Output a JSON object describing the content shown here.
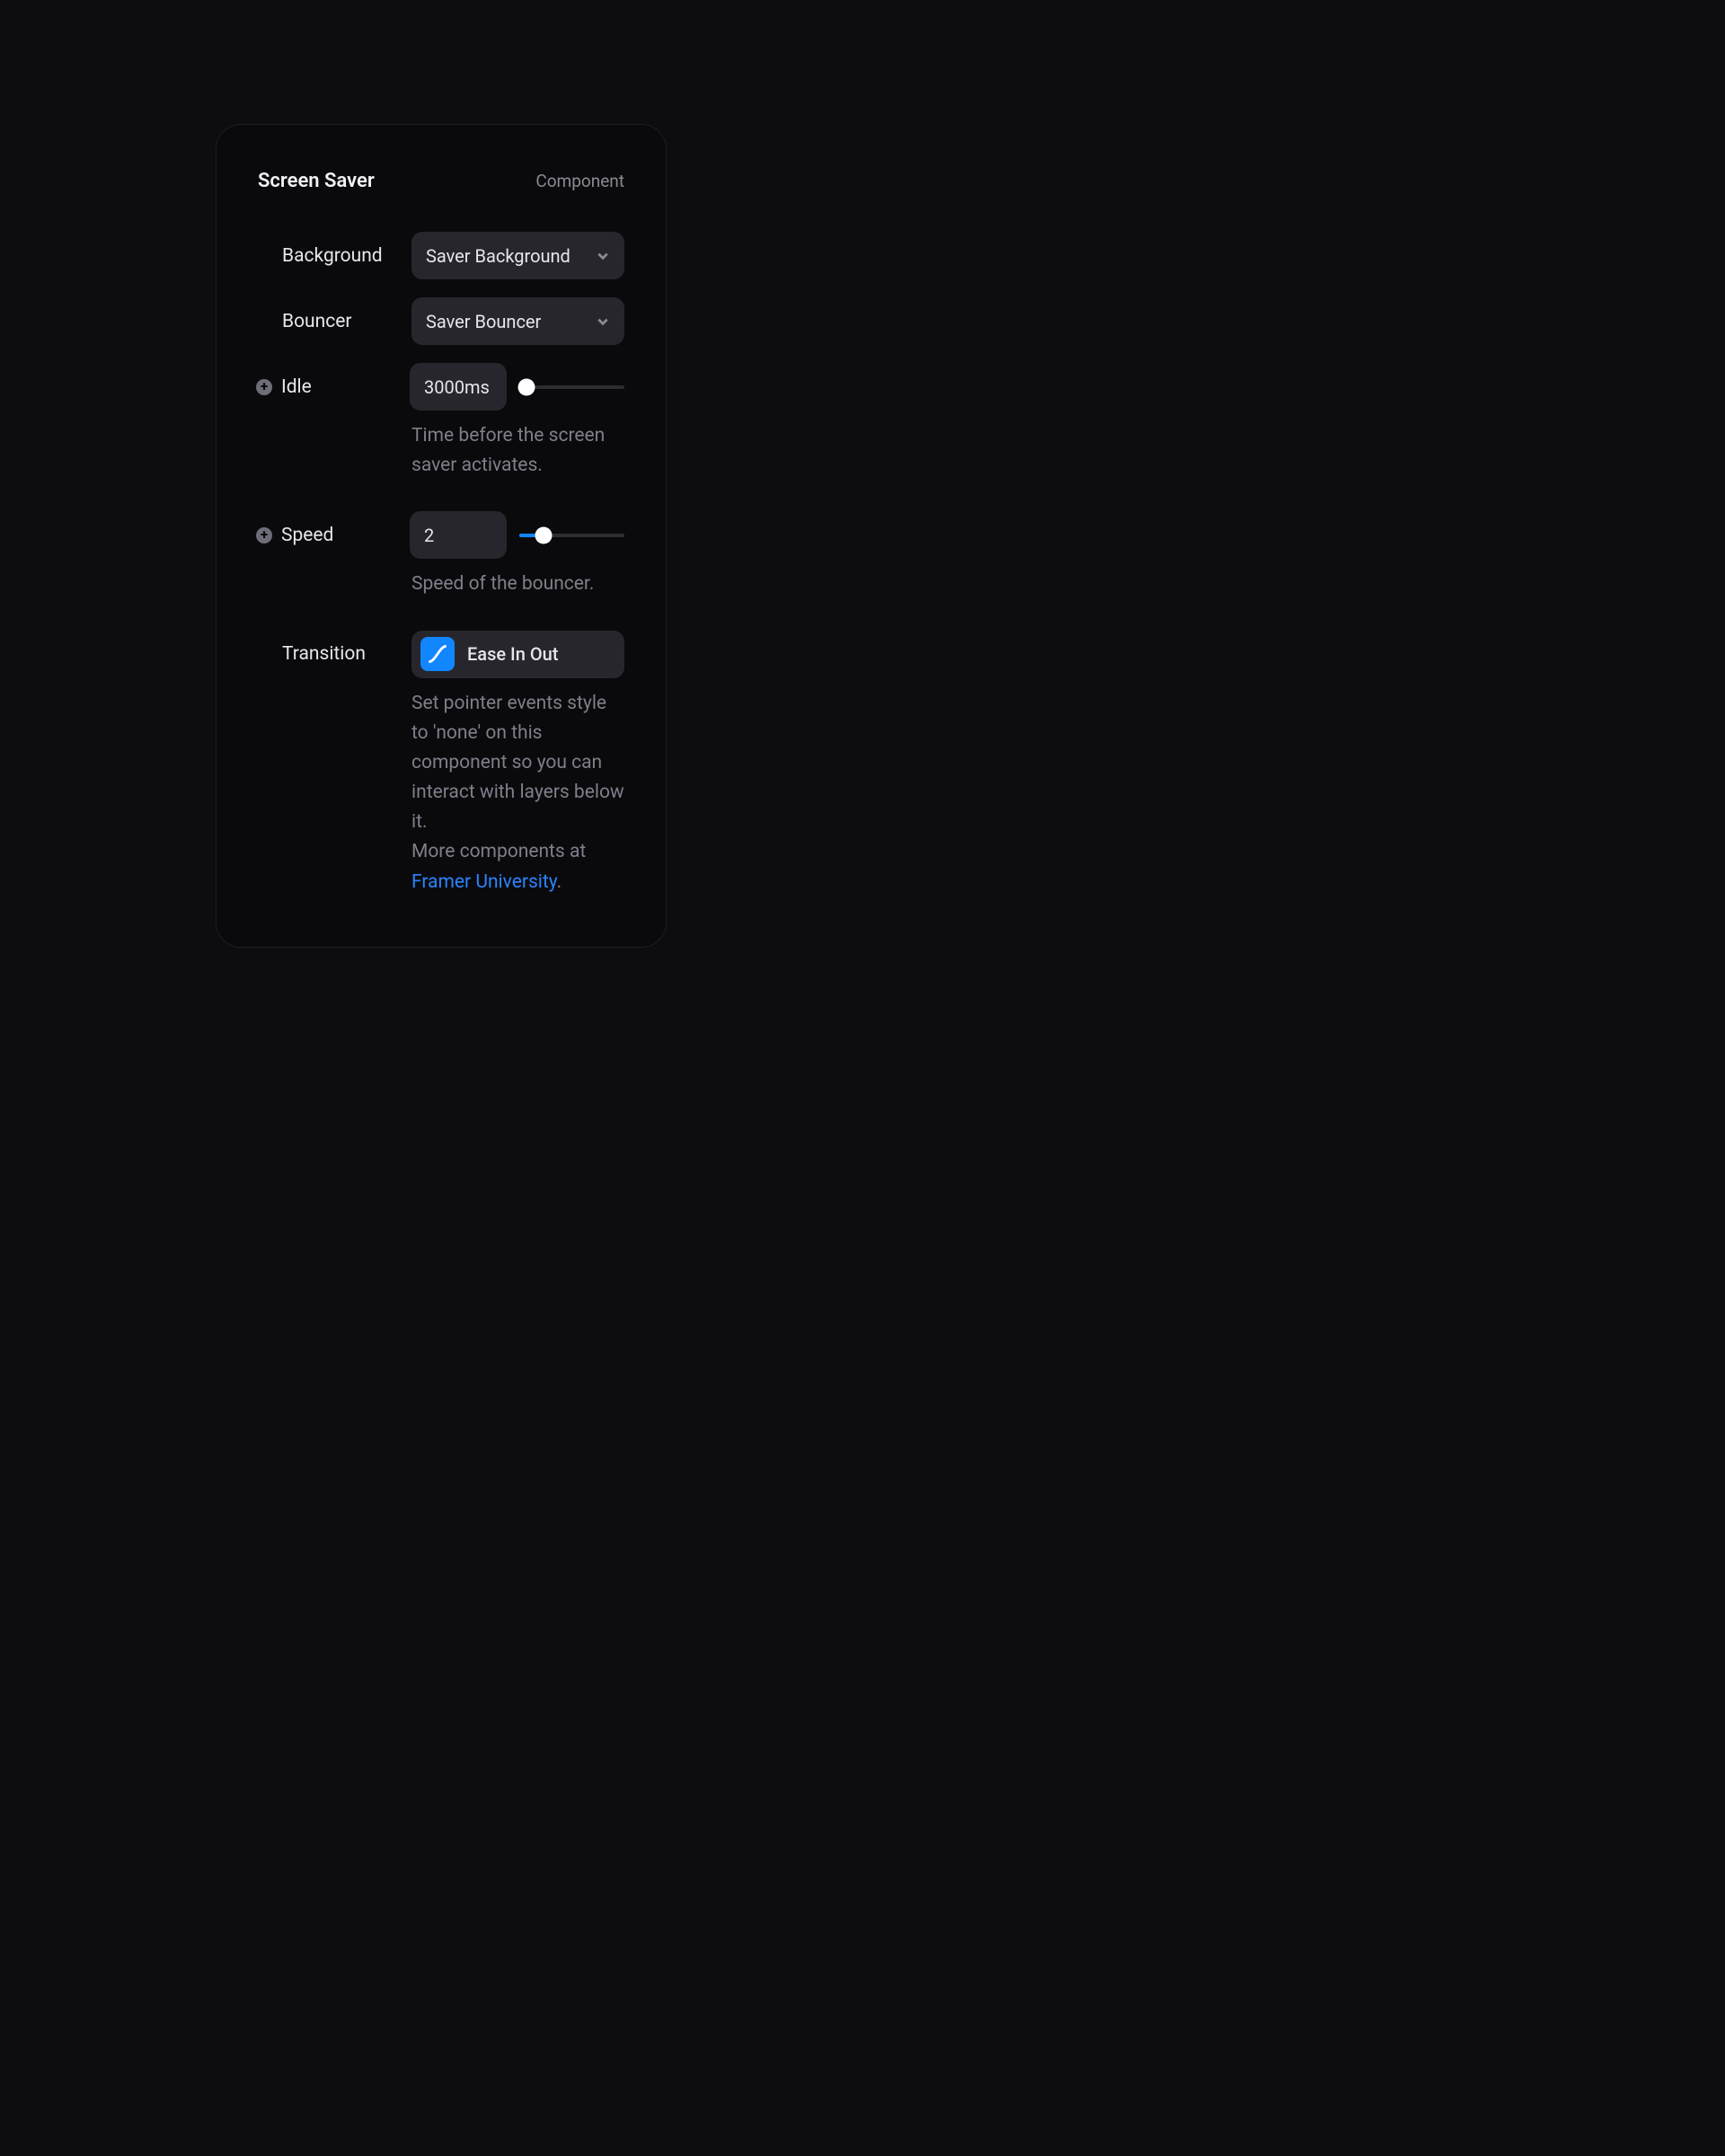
{
  "header": {
    "title": "Screen Saver",
    "type": "Component"
  },
  "props": {
    "background": {
      "label": "Background",
      "value": "Saver Background"
    },
    "bouncer": {
      "label": "Bouncer",
      "value": "Saver Bouncer"
    },
    "idle": {
      "label": "Idle",
      "value": "3000ms",
      "slider_percent": 7,
      "description": "Time before the screen saver activates."
    },
    "speed": {
      "label": "Speed",
      "value": "2",
      "slider_percent": 23,
      "description": "Speed of the bouncer."
    },
    "transition": {
      "label": "Transition",
      "value": "Ease In Out",
      "description_1": "Set pointer events style to 'none' on this component so you can interact with layers below it.",
      "description_2a": "More components at ",
      "link_text": "Framer University",
      "description_2b": "."
    }
  }
}
